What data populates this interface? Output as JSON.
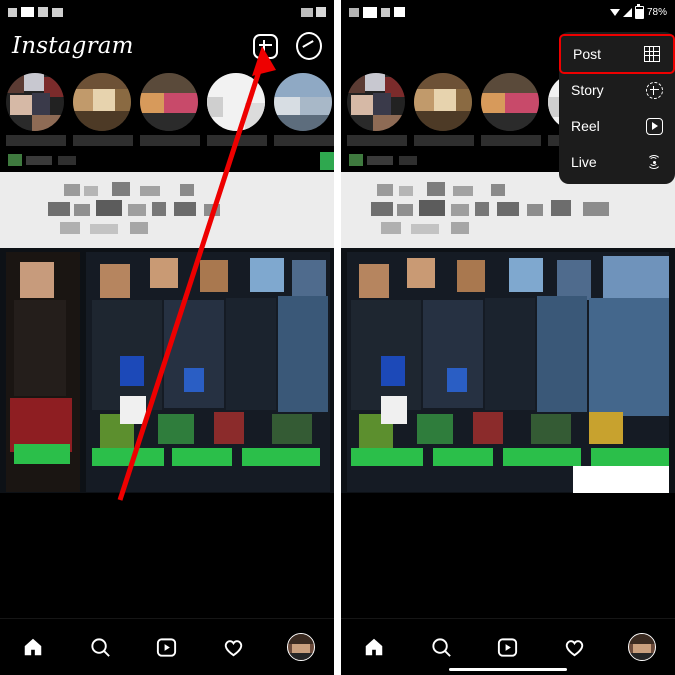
{
  "screens": [
    {
      "id": "left-screen",
      "statusbar": {
        "battery": "",
        "time_blocks": 4
      },
      "header": {
        "logo": "Instagram",
        "add_icon": "plus-square-icon",
        "messenger_icon": "messenger-icon"
      },
      "bottom_nav": [
        {
          "name": "home",
          "icon": "home-icon"
        },
        {
          "name": "search",
          "icon": "search-icon"
        },
        {
          "name": "reels",
          "icon": "reels-icon"
        },
        {
          "name": "activity",
          "icon": "heart-icon"
        },
        {
          "name": "profile",
          "icon": "avatar"
        }
      ],
      "annotation": {
        "arrow": "red-arrow-pointing-to-add-button",
        "color": "#ee0000"
      }
    },
    {
      "id": "right-screen",
      "statusbar": {
        "battery": "78%",
        "wifi_icon": "wifi-icon",
        "signal_icon": "signal-icon",
        "battery_icon": "battery-icon"
      },
      "header": {
        "logo": "",
        "add_icon": "plus-square-icon",
        "messenger_icon": "messenger-icon"
      },
      "create_menu": {
        "highlight_color": "#ee0000",
        "items": [
          {
            "label": "Post",
            "icon": "grid-icon",
            "highlighted": true
          },
          {
            "label": "Story",
            "icon": "story-plus-icon",
            "highlighted": false
          },
          {
            "label": "Reel",
            "icon": "reel-icon",
            "highlighted": false
          },
          {
            "label": "Live",
            "icon": "live-broadcast-icon",
            "highlighted": false
          }
        ]
      },
      "bottom_nav": [
        {
          "name": "home",
          "icon": "home-icon"
        },
        {
          "name": "search",
          "icon": "search-icon"
        },
        {
          "name": "reels",
          "icon": "reels-icon"
        },
        {
          "name": "activity",
          "icon": "heart-icon"
        },
        {
          "name": "profile",
          "icon": "avatar"
        }
      ]
    }
  ]
}
